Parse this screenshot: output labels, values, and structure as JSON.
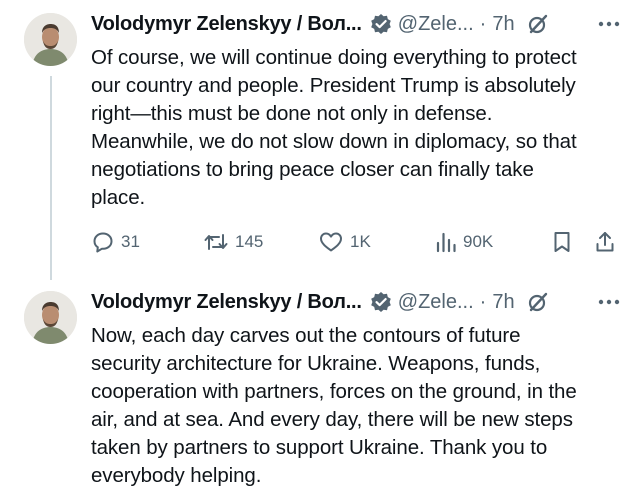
{
  "tweets": [
    {
      "author_name": "Volodymyr Zelenskyy / Вол...",
      "handle": "@Zele...",
      "separator": "·",
      "time": "7h",
      "text": "Of course, we will continue doing everything to protect\nour country and people. President Trump is absolutely\nright—this must be done not only in defense.\nMeanwhile, we do not slow down in diplomacy, so that\nnegotiations to bring peace closer can finally take\nplace.",
      "actions": {
        "replies": "31",
        "reposts": "145",
        "likes": "1K",
        "views": "90K"
      }
    },
    {
      "author_name": "Volodymyr Zelenskyy / Вол...",
      "handle": "@Zele...",
      "separator": "·",
      "time": "7h",
      "text": "Now, each day carves out the contours of future\nsecurity architecture for Ukraine. Weapons, funds,\ncooperation with partners, forces on the ground, in the\nair, and at sea. And every day, there will be new steps\ntaken by partners to support Ukraine. Thank you to\neverybody helping."
    }
  ],
  "colors": {
    "text": "#0f1419",
    "secondary": "#536471",
    "thread_line": "#cfd9de",
    "verified_badge": "#536471"
  },
  "icons": [
    "verified-badge-icon",
    "grok-icon",
    "more-icon",
    "reply-icon",
    "repost-icon",
    "like-icon",
    "views-icon",
    "bookmark-icon",
    "share-icon"
  ]
}
